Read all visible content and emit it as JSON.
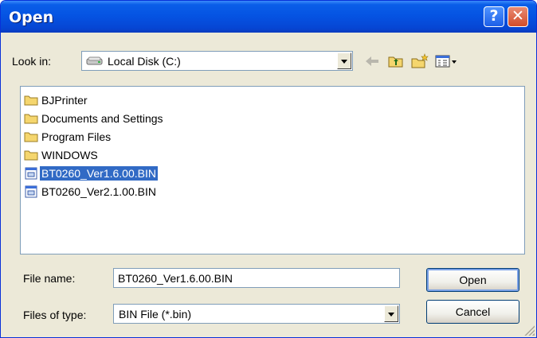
{
  "window": {
    "title": "Open"
  },
  "lookin": {
    "label": "Look in:",
    "value": "Local Disk (C:)"
  },
  "files": [
    {
      "name": "BJPrinter",
      "type": "folder",
      "selected": false
    },
    {
      "name": "Documents and Settings",
      "type": "folder",
      "selected": false
    },
    {
      "name": "Program Files",
      "type": "folder",
      "selected": false
    },
    {
      "name": "WINDOWS",
      "type": "folder",
      "selected": false
    },
    {
      "name": "BT0260_Ver1.6.00.BIN",
      "type": "file",
      "selected": true
    },
    {
      "name": "BT0260_Ver2.1.00.BIN",
      "type": "file",
      "selected": false
    }
  ],
  "filename": {
    "label": "File name:",
    "value": "BT0260_Ver1.6.00.BIN"
  },
  "filetype": {
    "label": "Files of type:",
    "value": "BIN File (*.bin)"
  },
  "buttons": {
    "open": "Open",
    "cancel": "Cancel"
  },
  "colors": {
    "selection": "#316ac5",
    "titlebar": "#0554e3",
    "face": "#ece9d8"
  },
  "icons": {
    "help": "?",
    "close": "✕"
  }
}
